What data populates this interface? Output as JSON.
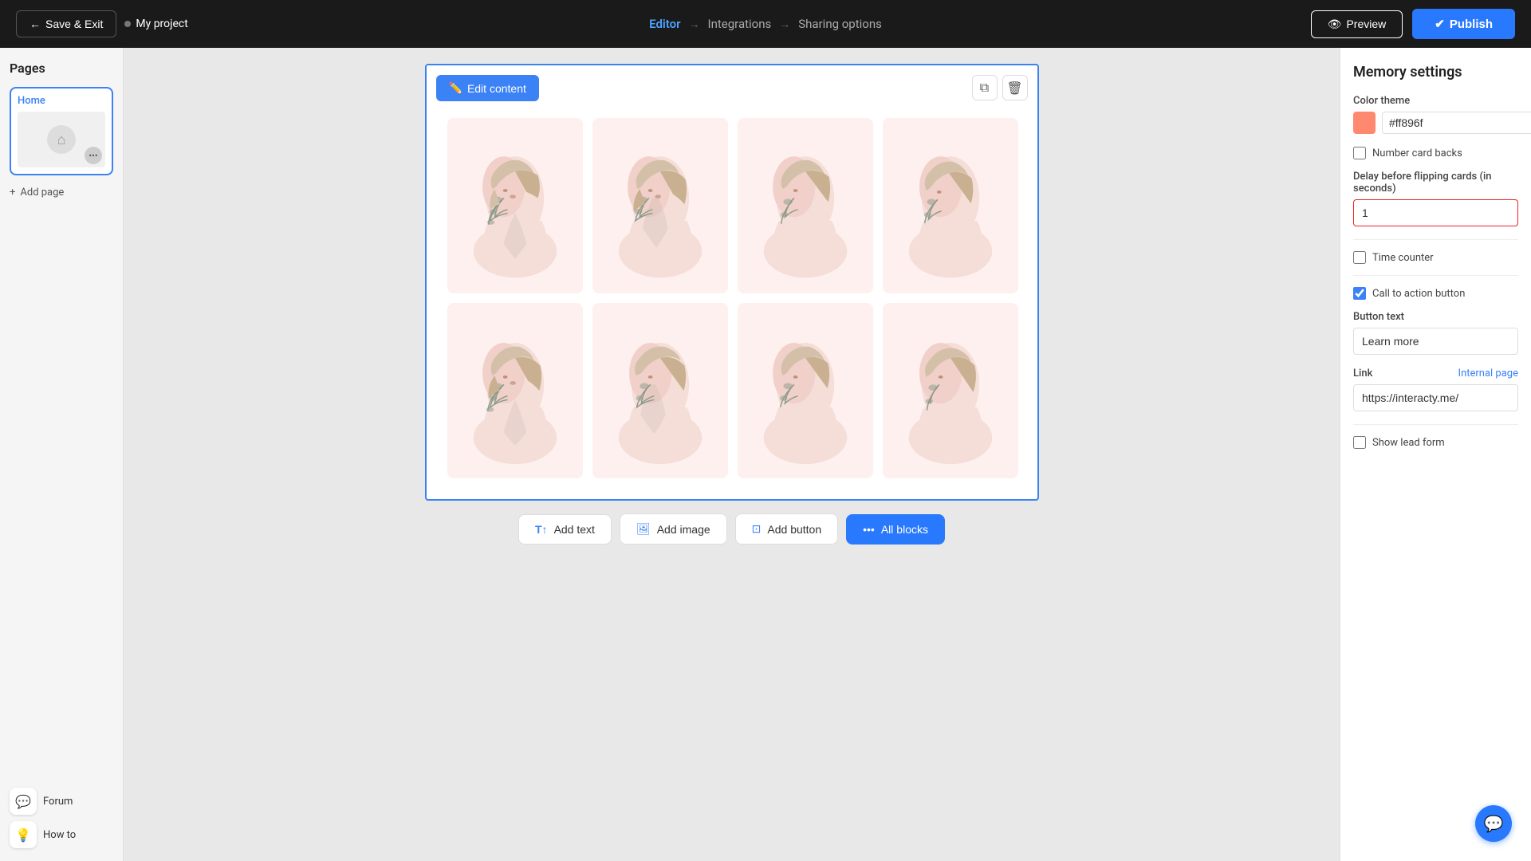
{
  "topNav": {
    "saveExit": "Save & Exit",
    "projectName": "My project",
    "steps": [
      {
        "label": "Editor",
        "state": "active"
      },
      {
        "label": "Integrations",
        "state": "inactive"
      },
      {
        "label": "Sharing options",
        "state": "inactive"
      }
    ],
    "preview": "Preview",
    "publish": "Publish"
  },
  "sidebar": {
    "title": "Pages",
    "page": {
      "label": "Home"
    },
    "addPage": "Add page",
    "bottomItems": [
      {
        "label": "Forum",
        "icon": "💬"
      },
      {
        "label": "How to",
        "icon": "💡"
      }
    ]
  },
  "canvas": {
    "editContent": "Edit content",
    "cards": [
      {
        "id": 1
      },
      {
        "id": 2
      },
      {
        "id": 3
      },
      {
        "id": 4
      },
      {
        "id": 5
      },
      {
        "id": 6
      },
      {
        "id": 7
      },
      {
        "id": 8
      }
    ]
  },
  "bottomToolbar": {
    "addText": "Add text",
    "addImage": "Add image",
    "addButton": "Add button",
    "allBlocks": "All blocks"
  },
  "rightPanel": {
    "title": "Memory settings",
    "colorTheme": {
      "label": "Color theme",
      "hex": "#ff896f",
      "displayHex": "#ff896f"
    },
    "numberCardBacks": {
      "label": "Number card backs",
      "checked": false
    },
    "delayLabel": "Delay before flipping cards (in seconds)",
    "delayValue": "1",
    "timeCounter": {
      "label": "Time counter",
      "checked": false
    },
    "callToAction": {
      "label": "Call to action button",
      "checked": true
    },
    "buttonTextLabel": "Button text",
    "buttonTextValue": "Learn more",
    "link": {
      "label": "Link",
      "internalPage": "Internal page",
      "value": "https://interacty.me/"
    },
    "showLeadForm": {
      "label": "Show lead form",
      "checked": false
    }
  }
}
